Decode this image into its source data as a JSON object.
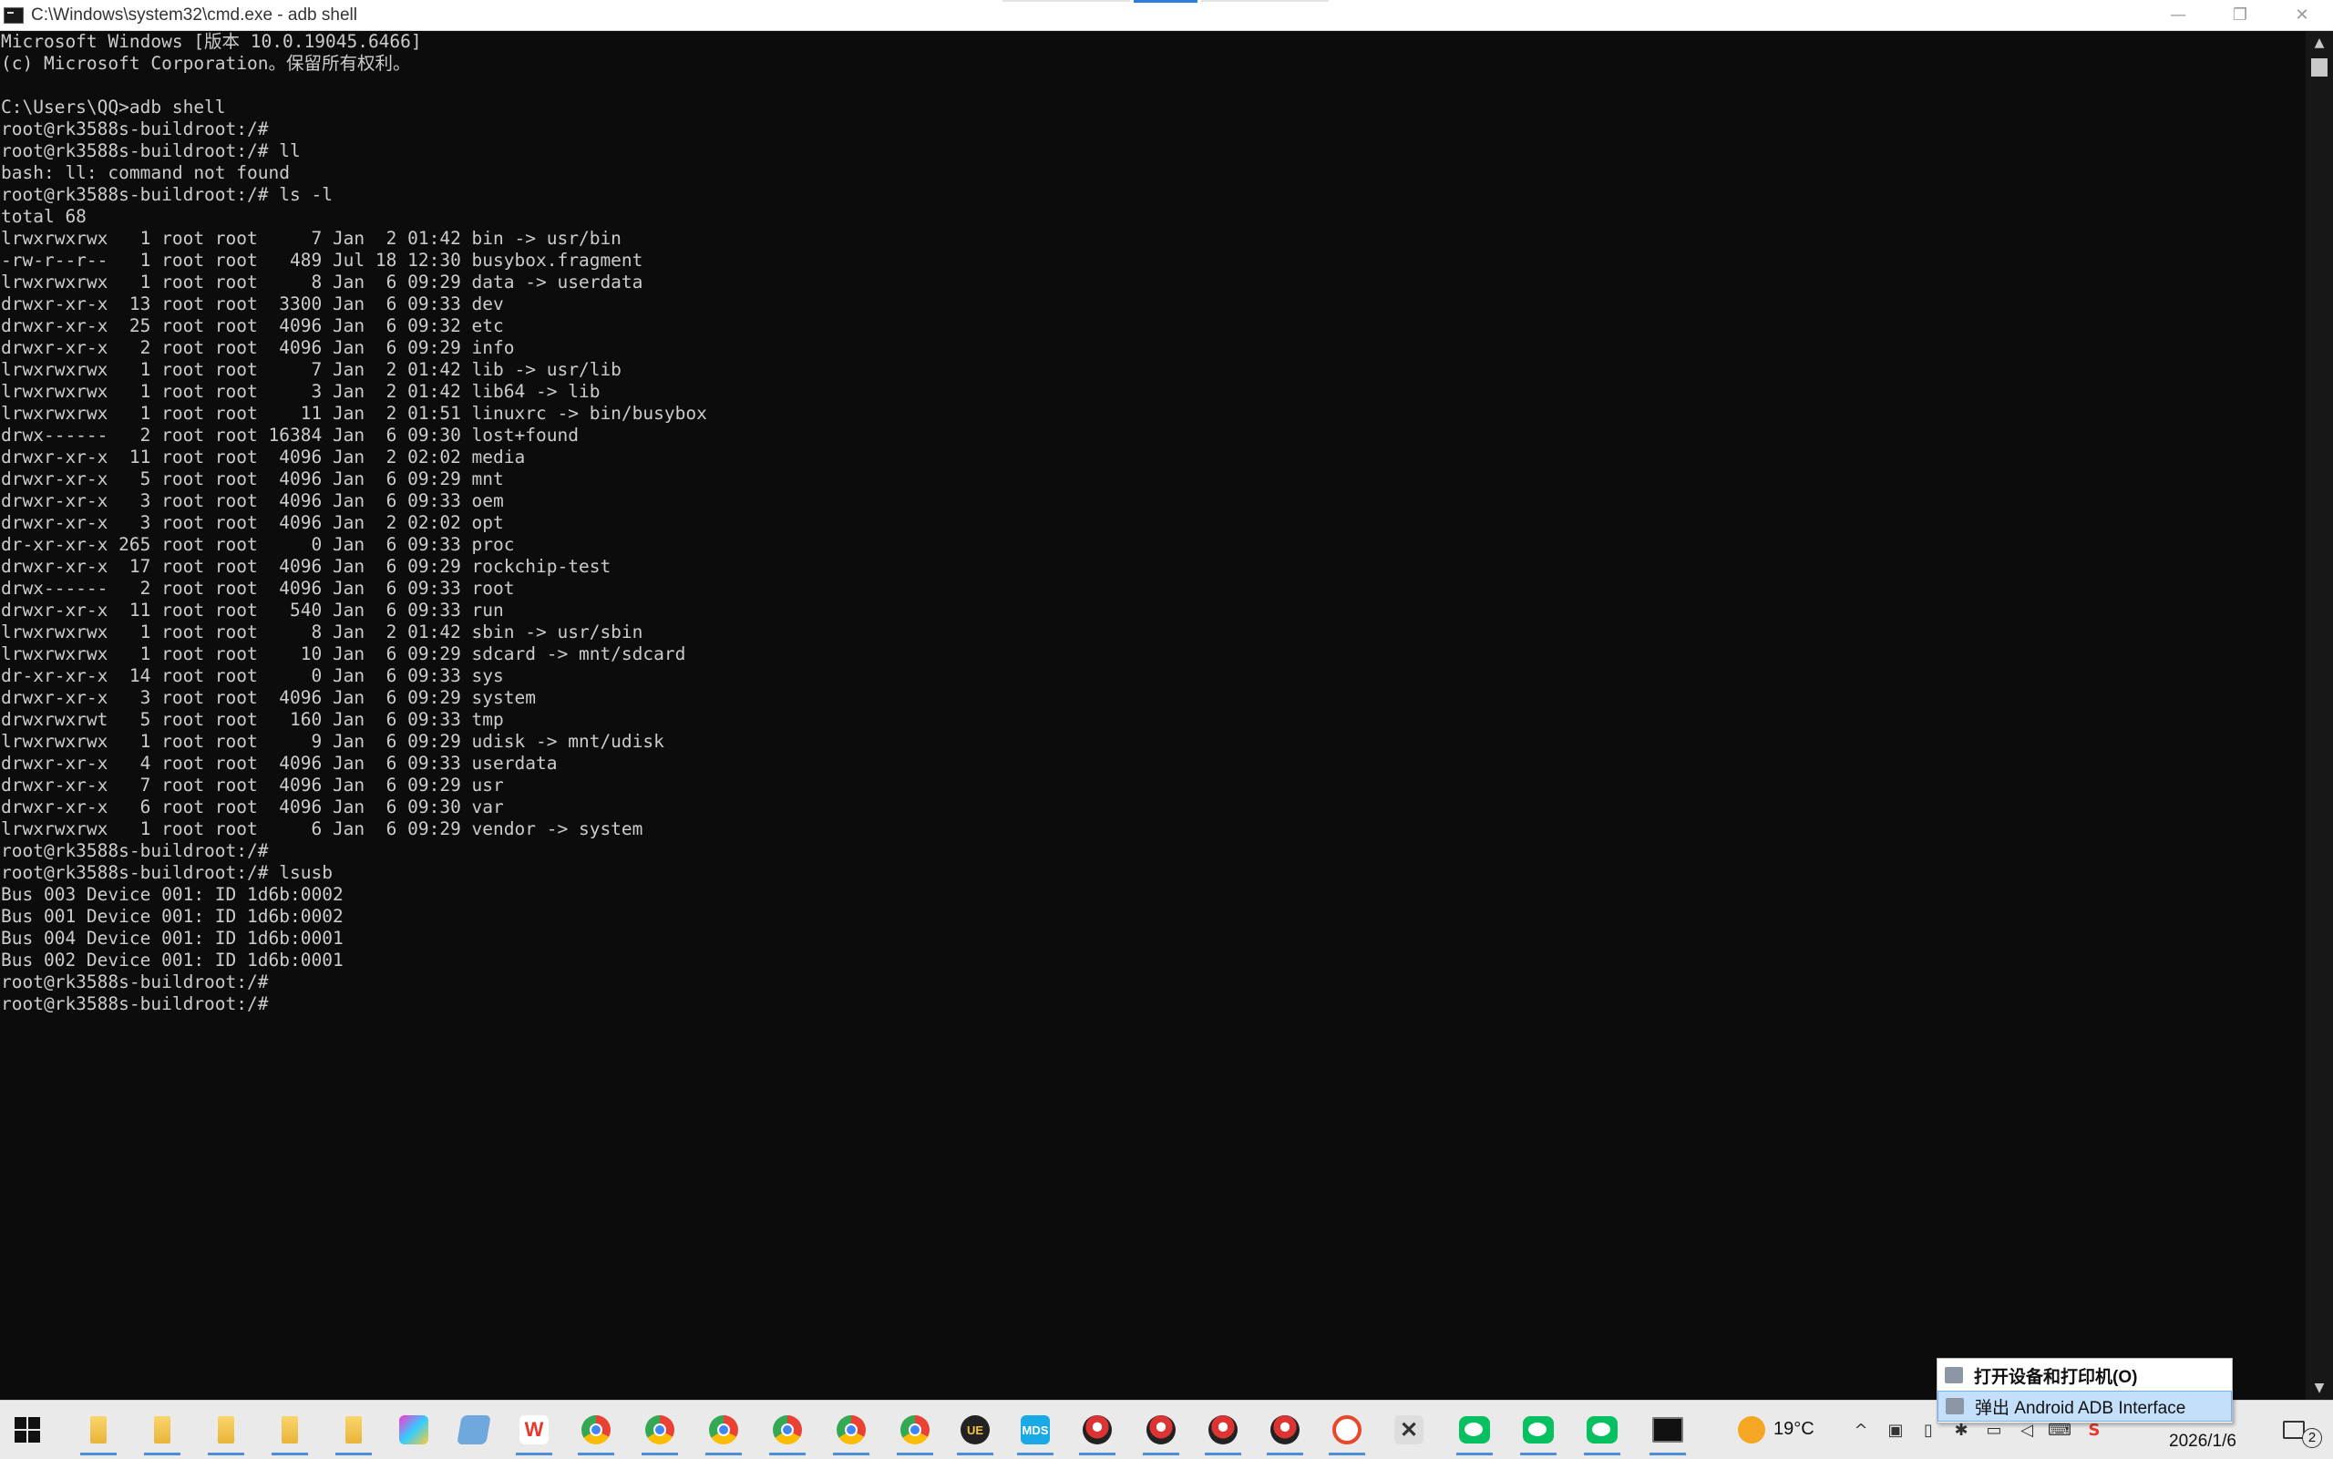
{
  "window": {
    "title": "C:\\Windows\\system32\\cmd.exe - adb  shell",
    "controls": {
      "minimize": "—",
      "restore": "❐",
      "close": "✕"
    }
  },
  "terminal": {
    "lines": [
      "Microsoft Windows [版本 10.0.19045.6466]",
      "(c) Microsoft Corporation。保留所有权利。",
      "",
      "C:\\Users\\QQ>adb shell",
      "root@rk3588s-buildroot:/#",
      "root@rk3588s-buildroot:/# ll",
      "bash: ll: command not found",
      "root@rk3588s-buildroot:/# ls -l",
      "total 68",
      "lrwxrwxrwx   1 root root     7 Jan  2 01:42 bin -> usr/bin",
      "-rw-r--r--   1 root root   489 Jul 18 12:30 busybox.fragment",
      "lrwxrwxrwx   1 root root     8 Jan  6 09:29 data -> userdata",
      "drwxr-xr-x  13 root root  3300 Jan  6 09:33 dev",
      "drwxr-xr-x  25 root root  4096 Jan  6 09:32 etc",
      "drwxr-xr-x   2 root root  4096 Jan  6 09:29 info",
      "lrwxrwxrwx   1 root root     7 Jan  2 01:42 lib -> usr/lib",
      "lrwxrwxrwx   1 root root     3 Jan  2 01:42 lib64 -> lib",
      "lrwxrwxrwx   1 root root    11 Jan  2 01:51 linuxrc -> bin/busybox",
      "drwx------   2 root root 16384 Jan  6 09:30 lost+found",
      "drwxr-xr-x  11 root root  4096 Jan  2 02:02 media",
      "drwxr-xr-x   5 root root  4096 Jan  6 09:29 mnt",
      "drwxr-xr-x   3 root root  4096 Jan  6 09:33 oem",
      "drwxr-xr-x   3 root root  4096 Jan  2 02:02 opt",
      "dr-xr-xr-x 265 root root     0 Jan  6 09:33 proc",
      "drwxr-xr-x  17 root root  4096 Jan  6 09:29 rockchip-test",
      "drwx------   2 root root  4096 Jan  6 09:33 root",
      "drwxr-xr-x  11 root root   540 Jan  6 09:33 run",
      "lrwxrwxrwx   1 root root     8 Jan  2 01:42 sbin -> usr/sbin",
      "lrwxrwxrwx   1 root root    10 Jan  6 09:29 sdcard -> mnt/sdcard",
      "dr-xr-xr-x  14 root root     0 Jan  6 09:33 sys",
      "drwxr-xr-x   3 root root  4096 Jan  6 09:29 system",
      "drwxrwxrwt   5 root root   160 Jan  6 09:33 tmp",
      "lrwxrwxrwx   1 root root     9 Jan  6 09:29 udisk -> mnt/udisk",
      "drwxr-xr-x   4 root root  4096 Jan  6 09:33 userdata",
      "drwxr-xr-x   7 root root  4096 Jan  6 09:29 usr",
      "drwxr-xr-x   6 root root  4096 Jan  6 09:30 var",
      "lrwxrwxrwx   1 root root     6 Jan  6 09:29 vendor -> system",
      "root@rk3588s-buildroot:/#",
      "root@rk3588s-buildroot:/# lsusb",
      "Bus 003 Device 001: ID 1d6b:0002",
      "Bus 001 Device 001: ID 1d6b:0002",
      "Bus 004 Device 001: ID 1d6b:0001",
      "Bus 002 Device 001: ID 1d6b:0001",
      "root@rk3588s-buildroot:/#",
      "root@rk3588s-buildroot:/#"
    ],
    "colors": {
      "background": "#0c0c0c",
      "foreground": "#cccccc"
    }
  },
  "scrollbar": {
    "up_arrow": "▲",
    "down_arrow": "▼"
  },
  "popup_menu": {
    "items": [
      {
        "label": "打开设备和打印机(O)",
        "selected": false
      },
      {
        "label": "弹出 Android ADB Interface",
        "selected": true
      }
    ]
  },
  "taskbar": {
    "weather": {
      "temperature": "19°C",
      "icon": "sun-icon"
    },
    "clock": {
      "date": "2026/1/6"
    },
    "notification_badge": "2",
    "tray": {
      "chevron": "^",
      "ime": "S"
    },
    "app_icons": [
      "file-explorer-icon",
      "file-explorer-icon",
      "file-explorer-icon",
      "file-explorer-icon",
      "file-explorer-icon",
      "paint-icon",
      "notepad-icon",
      "wps-icon",
      "chrome-icon",
      "chrome-icon",
      "chrome-icon",
      "chrome-icon",
      "chrome-icon",
      "chrome-icon",
      "ue-icon",
      "mds-icon",
      "pokeball-icon",
      "pokeball-icon",
      "pokeball-icon",
      "pokeball-icon",
      "swirl-icon",
      "tools-icon",
      "wechat-icon",
      "wechat-icon",
      "wechat-icon",
      "cmd-icon"
    ],
    "accent_color": "#4e8fdc",
    "wechat_color": "#07c160"
  }
}
